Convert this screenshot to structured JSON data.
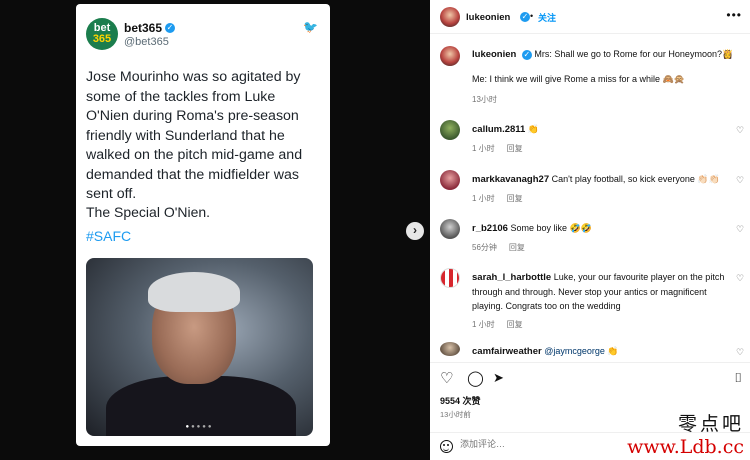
{
  "tweet": {
    "logo_line1": "bet",
    "logo_line2": "365",
    "display_name": "bet365",
    "handle": "@bet365",
    "body": "Jose Mourinho was so agitated by some of the tackles from Luke O'Nien during Roma's pre-season friendly with Sunderland that he walked on the pitch mid-game and demanded that the midfielder was sent off.",
    "signoff": "The Special O'Nien.",
    "hashtag": "#SAFC"
  },
  "post": {
    "author": "lukeonien",
    "follow_label": "关注",
    "caption_line1": "Mrs: Shall we go to Rome for our Honeymoon?👸",
    "caption_line2": "Me: I think we will give Rome a miss for a while 🙈🙊",
    "caption_time": "13小时"
  },
  "comments": [
    {
      "user": "callum.2811",
      "text": "👏",
      "time": "1 小时",
      "reply": "回复"
    },
    {
      "user": "markkavanagh27",
      "text": "Can't play football, so kick everyone 👏🏻👏🏻",
      "time": "1 小时",
      "reply": "回复"
    },
    {
      "user": "r_b2106",
      "text": "Some boy like 🤣🤣",
      "time": "56分钟",
      "reply": "回复"
    },
    {
      "user": "sarah_l_harbottle",
      "text": "Luke, your our favourite player on the pitch through and through. Never stop your antics or magnificent playing. Congrats too on the wedding",
      "time": "1 小时",
      "reply": "回复"
    },
    {
      "user": "camfairweather",
      "text": "@jaymcgeorge 👏",
      "time": "",
      "reply": ""
    }
  ],
  "stats": {
    "views": "9554 次赞",
    "ago": "13小时前"
  },
  "comment_box": {
    "placeholder": "添加评论…"
  },
  "watermark": {
    "line1": "零点吧",
    "line2": "www.Ldb.cc"
  },
  "colors": {
    "link": "#0095f6",
    "hashtag": "#1d9bf0",
    "bet365_green": "#1b7d4d"
  }
}
